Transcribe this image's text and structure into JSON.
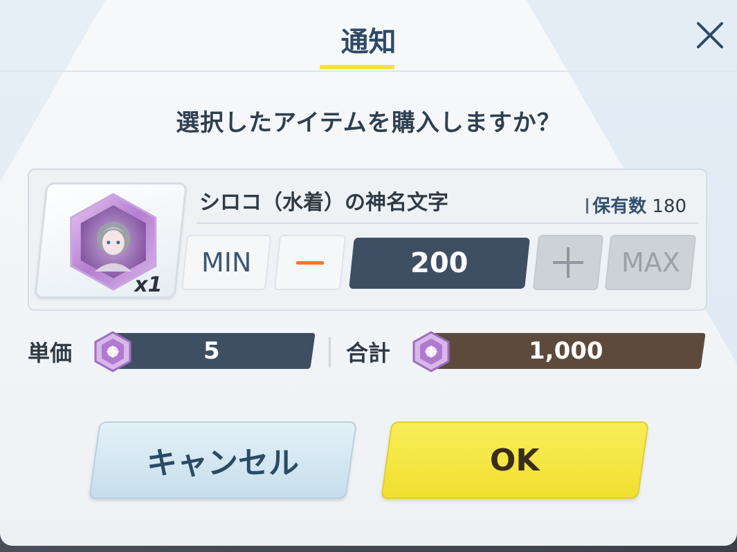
{
  "dialog": {
    "title": "通知",
    "question": "選択したアイテムを購入しますか？"
  },
  "item": {
    "name": "シロコ（水着）の神名文字",
    "quantity_badge": "x1",
    "owned_label": "保有数",
    "owned_count": "180"
  },
  "controls": {
    "min_label": "MIN",
    "max_label": "MAX",
    "quantity": "200"
  },
  "pricing": {
    "unit_label": "単価",
    "unit_price": "5",
    "total_label": "合計",
    "total_price": "1,000"
  },
  "buttons": {
    "cancel": "キャンセル",
    "ok": "OK"
  },
  "colors": {
    "title_underline": "#f2e23c",
    "unit_bar": "#3f4f63",
    "total_bar": "#5e4a3c",
    "ok_button": "#f5e640",
    "minus": "#f07a22"
  },
  "icons": {
    "close": "close-icon",
    "currency": "eligma-gem-icon",
    "item": "name-emblem-icon"
  }
}
